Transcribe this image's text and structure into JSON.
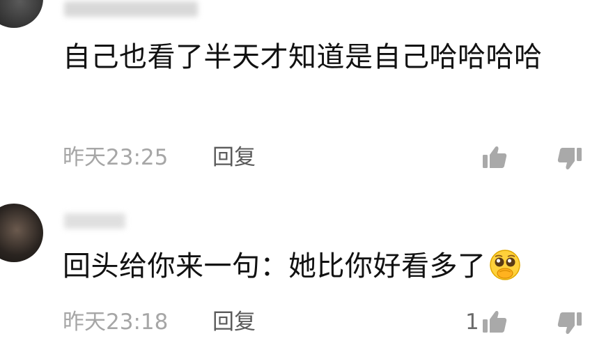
{
  "comments": [
    {
      "text": "自己也看了半天才知道是自己哈哈哈哈",
      "time": "昨天23:25",
      "reply_label": "回复"
    },
    {
      "text": "回头给你来一句：她比你好看多了",
      "emoji": "pleading-face-emoji",
      "time": "昨天23:18",
      "reply_label": "回复",
      "like_count": "1"
    }
  ],
  "icons": {
    "like": "thumbs-up-icon",
    "dislike": "thumbs-down-icon"
  },
  "colors": {
    "text": "#111111",
    "meta": "#a6a6a6",
    "reply": "#5a5a5a",
    "icon": "#a9a9a9"
  }
}
